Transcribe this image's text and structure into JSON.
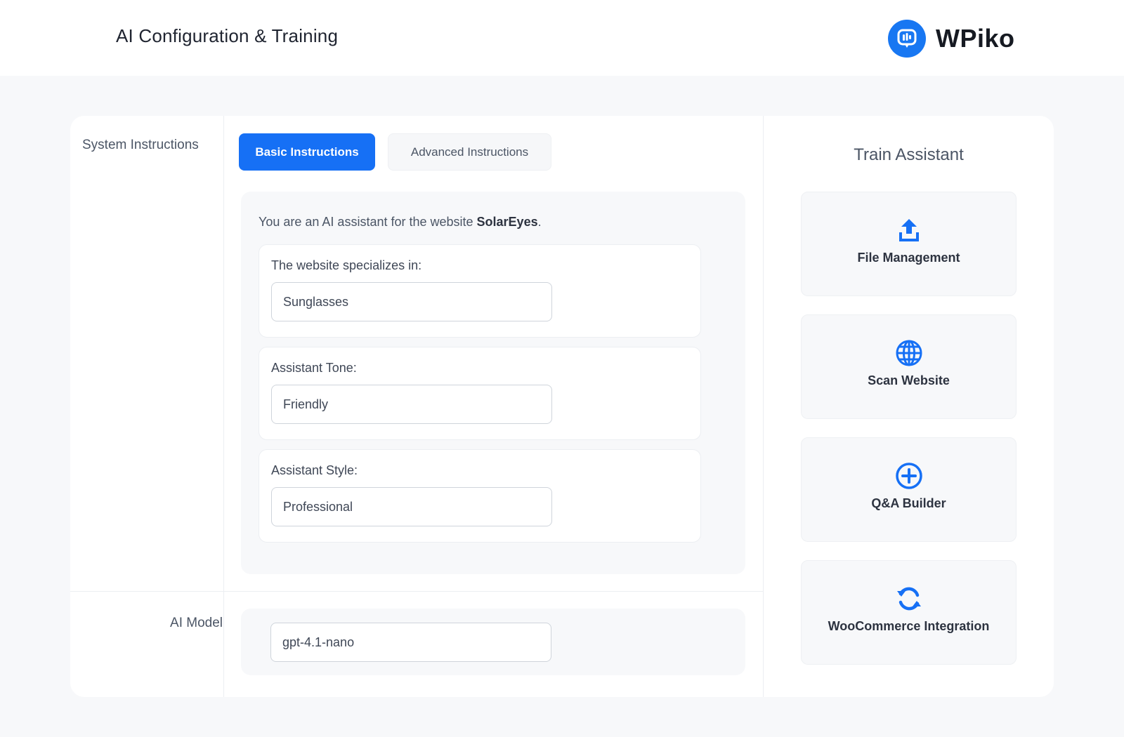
{
  "header": {
    "title": "AI Configuration & Training",
    "brand_name": "WPiko",
    "brand_color": "#1877f2"
  },
  "system_instructions": {
    "label": "System Instructions",
    "tabs": [
      {
        "label": "Basic Instructions",
        "active": true
      },
      {
        "label": "Advanced Instructions",
        "active": false
      }
    ],
    "intro_prefix": "You are an AI assistant for the website ",
    "website_name": "SolarEyes",
    "intro_suffix": ".",
    "fields": [
      {
        "label": "The website specializes in:",
        "value": "Sunglasses"
      },
      {
        "label": "Assistant Tone:",
        "value": "Friendly"
      },
      {
        "label": "Assistant Style:",
        "value": "Professional"
      }
    ]
  },
  "ai_model": {
    "label": "AI Model",
    "value": "gpt-4.1-nano"
  },
  "train_assistant": {
    "title": "Train Assistant",
    "items": [
      {
        "label": "File Management",
        "icon": "upload-icon"
      },
      {
        "label": "Scan Website",
        "icon": "globe-icon"
      },
      {
        "label": "Q&A Builder",
        "icon": "plus-circle-icon"
      },
      {
        "label": "WooCommerce Integration",
        "icon": "sync-icon"
      }
    ]
  },
  "accent_color": "#1670f5"
}
